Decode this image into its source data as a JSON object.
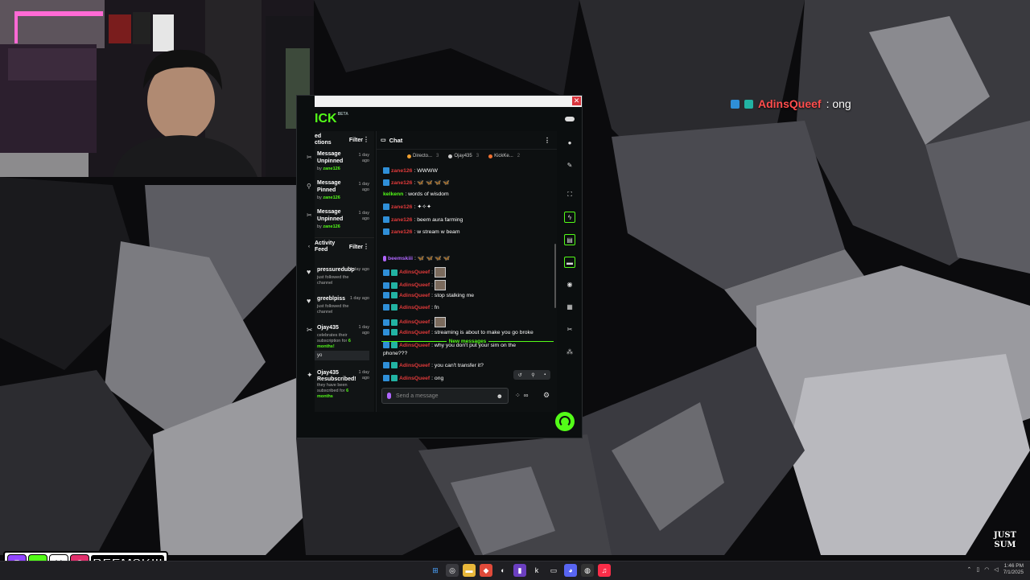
{
  "overlay": {
    "username": "AdinsQueef",
    "text": ": ong"
  },
  "kick": {
    "logo": "ICK",
    "logo_sup": "BETA",
    "pinned_panel": {
      "title": "ed ctions",
      "filter": "Filter"
    },
    "pinned": [
      {
        "title": "Message Unpinned",
        "by_prefix": "by ",
        "by": "zane126",
        "ago": "1 day ago"
      },
      {
        "title": "Message Pinned",
        "by_prefix": "by ",
        "by": "zane126",
        "ago": "1 day ago"
      },
      {
        "title": "Message Unpinned",
        "by_prefix": "by ",
        "by": "zane126",
        "ago": "1 day ago"
      }
    ],
    "activity_panel": {
      "title": "Activity Feed",
      "filter": "Filter"
    },
    "activity": [
      {
        "name": "pressuredubp",
        "desc": "just followed the channel",
        "ago": "1 day ago"
      },
      {
        "name": "greeblpiss",
        "desc": "just followed the channel",
        "ago": "1 day ago"
      },
      {
        "name": "Ojay435",
        "desc": "celebrates their subscription for",
        "months": "6 months!",
        "ago": "1 day ago",
        "message": "yo"
      },
      {
        "name": "Ojay435 Resubscribed!",
        "desc": "they have been subscribed for",
        "months": "6 months",
        "ago": "1 day ago"
      }
    ],
    "chat": {
      "title": "Chat",
      "tabs": [
        {
          "label": "Directo...",
          "count": "3",
          "color": "#f0a030"
        },
        {
          "label": "Ojay435",
          "count": "3",
          "color": "#cccccc"
        },
        {
          "label": "KickKe...",
          "count": "2",
          "color": "#f07030"
        }
      ],
      "messages": [
        {
          "user": "zane126",
          "text": ": WWWW",
          "color": "red",
          "badges": 1
        },
        {
          "user": "zane126",
          "text": ": ",
          "emotes": "🦋 🦋 🦋 🦋",
          "color": "red",
          "badges": 1
        },
        {
          "user": "kelkenn",
          "text": ": words of wisdom",
          "color": "green",
          "badges": 0
        },
        {
          "user": "zane126",
          "text": ": ",
          "emotes": "✦✧✦",
          "color": "red",
          "badges": 1
        },
        {
          "user": "zane126",
          "text": ": beem aura farming",
          "color": "red",
          "badges": 1
        },
        {
          "user": "zane126",
          "text": ": w stream w beam",
          "color": "red",
          "badges": 1
        }
      ],
      "new_messages_label": "New messages",
      "messages_after": [
        {
          "user": "beemskiii",
          "text": ": ",
          "emotes": "🦋 🦋 🦋 🦋",
          "color": "purple",
          "badges": 0
        },
        {
          "user": "AdinsQueef",
          "text": ": ",
          "photo": true,
          "color": "red",
          "badges": 2
        },
        {
          "user": "AdinsQueef",
          "text": ": ",
          "photo": true,
          "color": "red",
          "badges": 2
        },
        {
          "user": "AdinsQueef",
          "text": ": stop stalking me",
          "color": "red",
          "badges": 2
        },
        {
          "user": "AdinsQueef",
          "text": ": fn",
          "color": "red",
          "badges": 2
        },
        {
          "user": "AdinsQueef",
          "text": ": ",
          "photo": true,
          "color": "red",
          "badges": 2
        },
        {
          "user": "AdinsQueef",
          "text": ": streaming is about to make you go broke",
          "color": "red",
          "badges": 2
        },
        {
          "user": "AdinsQueef",
          "text": ": why you don't put your sim on the",
          "text2": "phone???",
          "color": "red",
          "badges": 2
        },
        {
          "user": "AdinsQueef",
          "text": ": you can't transfer it?",
          "color": "red",
          "badges": 2
        },
        {
          "user": "AdinsQueef",
          "text": ": ong",
          "color": "red",
          "badges": 2
        }
      ],
      "input_placeholder": "Send a message"
    }
  },
  "socials": {
    "handle": "BEEMSKIII"
  },
  "watermark": {
    "line1": "JUST",
    "line2": "SUM"
  },
  "tray": {
    "time": "1:46 PM",
    "date": "7/1/2025"
  },
  "colors": {
    "kick_green": "#53fc18",
    "username_red": "#e03a3a"
  }
}
